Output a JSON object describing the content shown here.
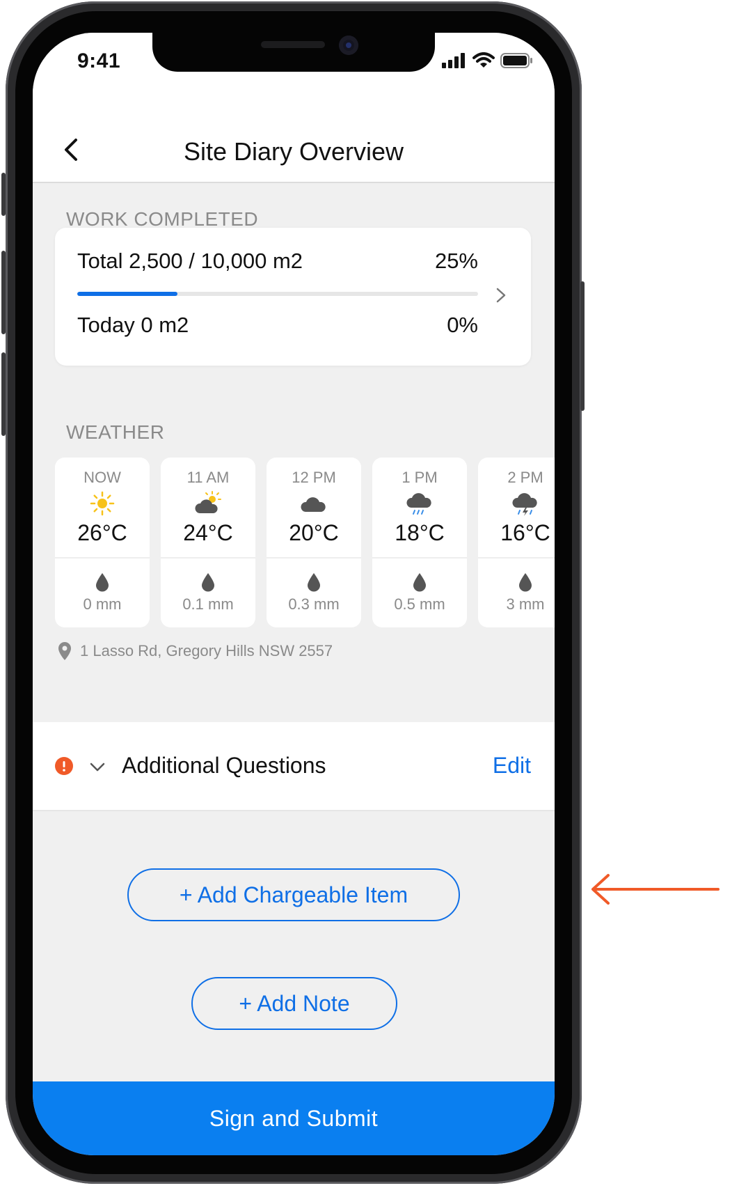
{
  "status_bar": {
    "time": "9:41"
  },
  "nav": {
    "title": "Site Diary Overview"
  },
  "work_completed": {
    "label": "WORK COMPLETED",
    "total_text": "Total 2,500 / 10,000 m2",
    "total_percent": "25%",
    "progress_fraction": 0.25,
    "today_text": "Today 0 m2",
    "today_percent": "0%"
  },
  "weather": {
    "label": "WEATHER",
    "forecasts": [
      {
        "time": "NOW",
        "icon": "sun-icon",
        "temp": "26°C",
        "rain": "0 mm"
      },
      {
        "time": "11 AM",
        "icon": "partly-cloudy-icon",
        "temp": "24°C",
        "rain": "0.1 mm"
      },
      {
        "time": "12 PM",
        "icon": "cloud-icon",
        "temp": "20°C",
        "rain": "0.3 mm"
      },
      {
        "time": "1 PM",
        "icon": "rain-cloud-icon",
        "temp": "18°C",
        "rain": "0.5 mm"
      },
      {
        "time": "2 PM",
        "icon": "thunderstorm-icon",
        "temp": "16°C",
        "rain": "3 mm"
      }
    ],
    "address": "1 Lasso Rd, Gregory Hills NSW 2557"
  },
  "additional_questions": {
    "title": "Additional Questions",
    "edit_label": "Edit"
  },
  "buttons": {
    "add_chargeable_item": "+ Add Chargeable Item",
    "add_note": "+ Add Note",
    "sign_and_submit": "Sign and Submit"
  },
  "colors": {
    "accent": "#0f6fe6",
    "submit_bar": "#0a7ff0",
    "alert": "#f05a28",
    "annotation_arrow": "#f05a28",
    "sun": "#f7c21a"
  }
}
